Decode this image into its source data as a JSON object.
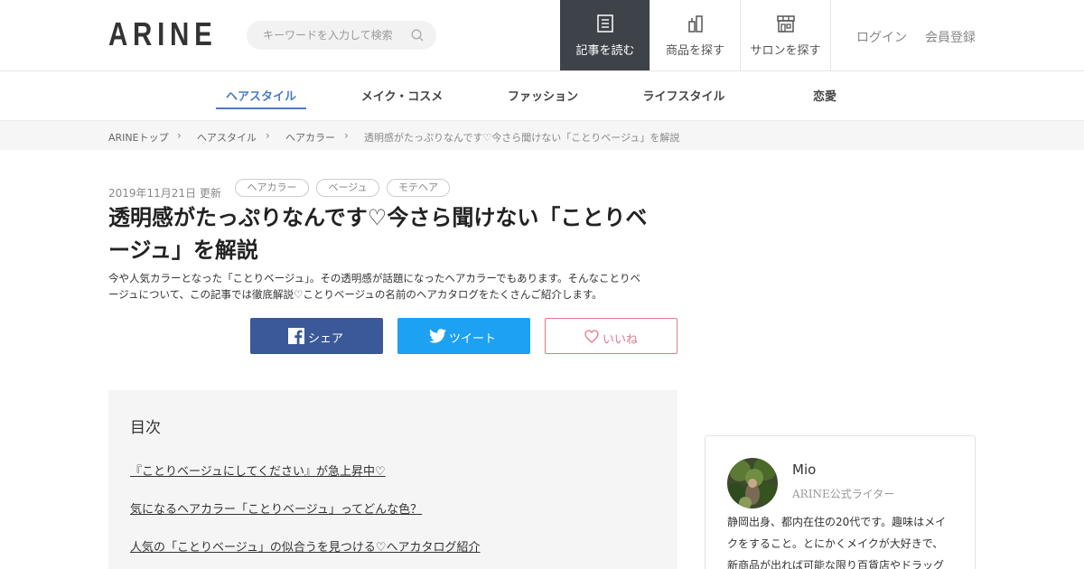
{
  "header": {
    "logo": "ARINE",
    "search_placeholder": "キーワードを入力して検索",
    "nav": [
      {
        "label": "記事を読む",
        "icon": "document-icon"
      },
      {
        "label": "商品を探す",
        "icon": "product-bottles-icon"
      },
      {
        "label": "サロンを探す",
        "icon": "storefront-icon"
      }
    ],
    "login": "ログイン",
    "register": "会員登録"
  },
  "categories": [
    "ヘアスタイル",
    "メイク・コスメ",
    "ファッション",
    "ライフスタイル",
    "恋愛"
  ],
  "breadcrumb": [
    "ARINEトップ",
    "ヘアスタイル",
    "ヘアカラー",
    "透明感がたっぷりなんです♡今さら聞けない「ことりベージュ」を解説"
  ],
  "article": {
    "date": "2019年11月21日 更新",
    "tags": [
      "ヘアカラー",
      "ベージュ",
      "モテヘア"
    ],
    "title_line1": "透明感がたっぷりなんです♡今さら聞けない「ことりベ",
    "title_line2": "ージュ」を解説",
    "lead_line1": "今や人気カラーとなった「ことりベージュ」。その透明感が話題になったヘアカラーでもあります。そんなことりベ",
    "lead_line2": "ージュについて、この記事では徹底解説♡ことりベージュの名前のヘアカタログをたくさんご紹介します。",
    "share_facebook": "シェア",
    "share_twitter": "ツイート",
    "like": "いいね"
  },
  "toc": {
    "title": "目次",
    "items": [
      "『ことりベージュにしてください』が急上昇中♡",
      "気になるヘアカラー「ことりベージュ」ってどんな色？",
      "人気の「ことりベージュ」の似合うを見つける♡ヘアカタログ紹介"
    ]
  },
  "author": {
    "name": "Mio",
    "role": "ARINE公式ライター",
    "bio_line1": "静岡出身、都内在住の20代です。趣味はメイ",
    "bio_line2": "クをすること。とにかくメイクが大好きで、",
    "bio_line3": "新商品が出れば可能な限り百貨店やドラッグ"
  },
  "colors": {
    "accent": "#4a7bc3",
    "nav_active": "#3e4249",
    "facebook": "#3b5998",
    "twitter": "#1da1f2",
    "like": "#e07b8a"
  }
}
